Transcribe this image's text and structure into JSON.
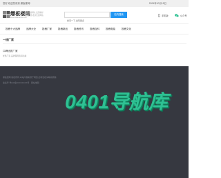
{
  "topbar": {
    "welcome": "您好,欢迎您来到 爆板楼网!",
    "date": "2024年10月15日"
  },
  "header": {
    "logo_name": "爆板楼网",
    "logo_url": "www.baobanlou.com",
    "slogan_line1": "汇聚各类网址,发现精彩",
    "slogan_line2": "网站分类,收录优质网站",
    "search_placeholder": "搜索一下,发现更多",
    "search_button": "站内搜索",
    "mobile_label": "手机版",
    "wechat_label": "公众号"
  },
  "nav": [
    "投稿十大品牌",
    "品牌大全",
    "投稿厂家",
    "投稿新品",
    "投稿资讯",
    "投稿百科",
    "投稿电脑",
    "投稿文化"
  ],
  "section": {
    "title": "一线厂家"
  },
  "card": {
    "title": "口碑优质厂家",
    "desc": "优质厂家,品质保障值得信赖"
  },
  "footer": {
    "copyright": "爆板楼网 版权所有,本站内容来源于网络,如有侵权请联系删除",
    "icp": "备案号 粤ICP备XXXXXXXX号  · 网站地图"
  },
  "watermark": "0401导航库",
  "colors": {
    "accent": "#2196f3",
    "footer_bg": "#363840",
    "watermark": "#2ec193"
  }
}
